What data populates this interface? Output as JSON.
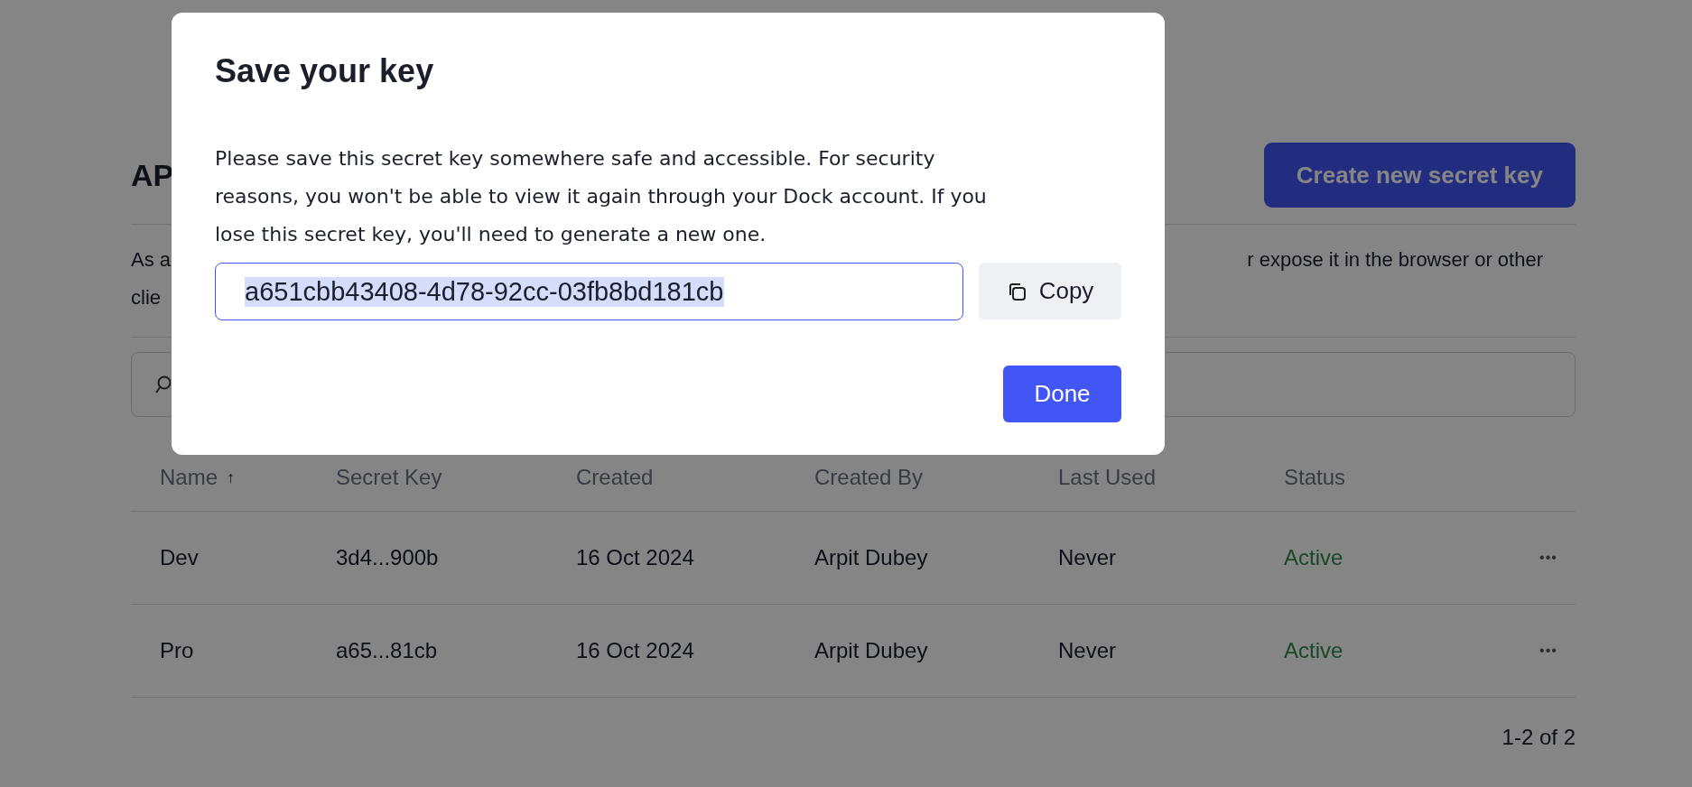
{
  "page": {
    "heading": "AP",
    "create_button": "Create new secret key",
    "description_lines": [
      {
        "left": "As a",
        "right": "r expose it in the browser or other"
      },
      {
        "left": "clie"
      }
    ]
  },
  "table": {
    "columns": [
      {
        "label": "Name",
        "sort_indicator": "↑"
      },
      {
        "label": "Secret Key"
      },
      {
        "label": "Created"
      },
      {
        "label": "Created By"
      },
      {
        "label": "Last Used"
      },
      {
        "label": "Status"
      }
    ],
    "rows": [
      {
        "name": "Dev",
        "secret_key": "3d4...900b",
        "created": "16 Oct 2024",
        "created_by": "Arpit Dubey",
        "last_used": "Never",
        "status": "Active",
        "menu": "•••"
      },
      {
        "name": "Pro",
        "secret_key": "a65...81cb",
        "created": "16 Oct 2024",
        "created_by": "Arpit Dubey",
        "last_used": "Never",
        "status": "Active",
        "menu": "•••"
      }
    ]
  },
  "pagination": "1-2 of 2",
  "dialog": {
    "title": "Save your key",
    "message": "Please save this secret key somewhere safe and accessible. For security reasons, you won't be able to view it again through your Dock account. If you lose this secret key, you'll need to generate a new one.",
    "key_field": {
      "value": "a651cbb43408-4d78-92cc-03fb8bd181cb",
      "focused": true,
      "text_selected": true
    },
    "copy_button": "Copy",
    "done_button": "Done"
  }
}
